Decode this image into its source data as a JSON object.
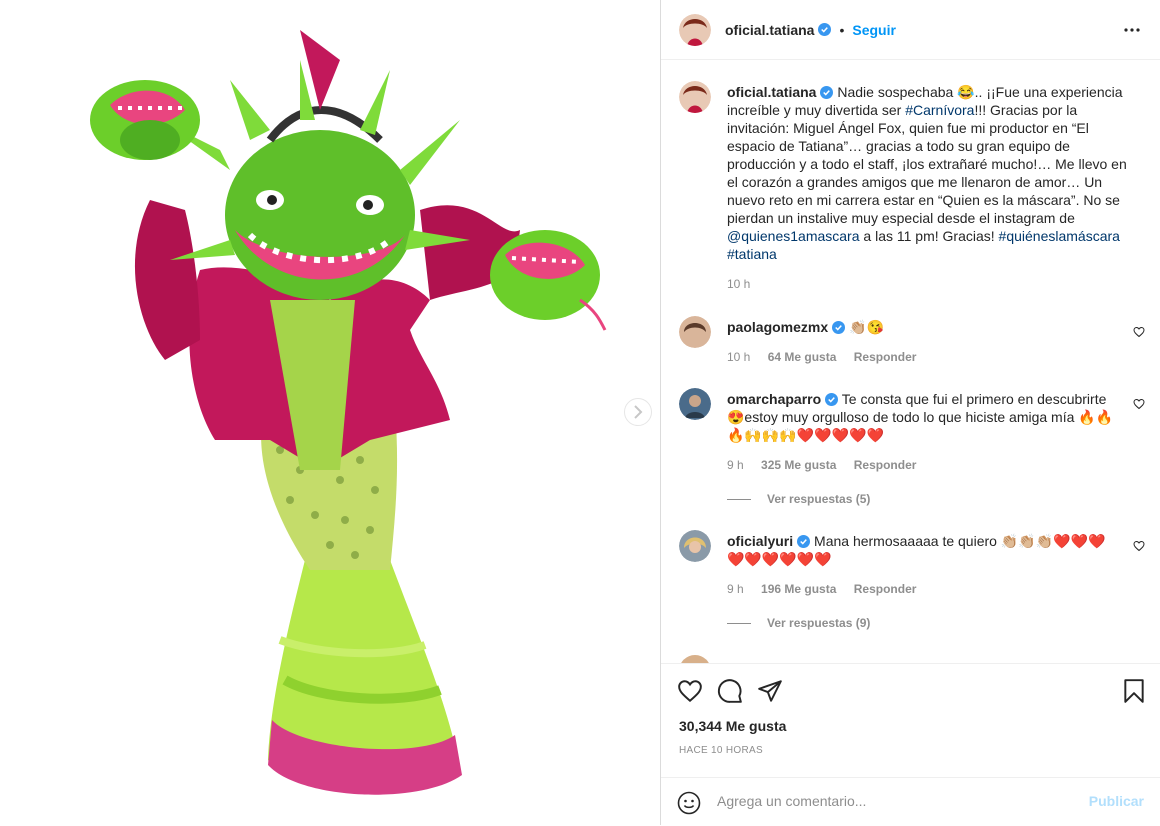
{
  "post": {
    "author": "oficial.tatiana",
    "follow_label": "Seguir",
    "dot": "•",
    "caption_author": "oficial.tatiana",
    "caption_text_1": "Nadie sospechaba 😂.. ¡¡Fue una experiencia increíble y muy divertida ser ",
    "caption_tag_1": "#Carnívora",
    "caption_text_2": "!!! Gracias por la invitación: Miguel Ángel Fox, quien fue mi productor en “El espacio de Tatiana”… gracias a todo su gran equipo de producción y a todo el staff, ¡los extrañaré mucho!… Me llevo en el corazón a grandes amigos que me llenaron de amor… Un nuevo reto en mi carrera estar en “Quien es la máscara”. No se pierdan un instalive muy especial desde el instagram de ",
    "caption_mention": "@quienes1amascara",
    "caption_text_3": " a las 11 pm! Gracias! ",
    "caption_tag_2": "#quiéneslamáscara",
    "caption_tag_3": "#tatiana",
    "caption_time": "10 h"
  },
  "comments": [
    {
      "user": "paolagomezmx",
      "text": "👏🏼😘",
      "time": "10 h",
      "likes": "64 Me gusta",
      "reply": "Responder"
    },
    {
      "user": "omarchaparro",
      "text": "Te consta que fui el primero en descubrirte 😍estoy muy orgulloso de todo lo que hiciste amiga mía 🔥🔥🔥🙌🙌🙌❤️❤️❤️❤️❤️",
      "time": "9 h",
      "likes": "325 Me gusta",
      "reply": "Responder",
      "view_replies": "Ver respuestas (5)"
    },
    {
      "user": "oficialyuri",
      "text": "Mana hermosaaaaa te quiero 👏🏼👏🏼👏🏼❤️❤️❤️❤️❤️❤️❤️❤️❤️",
      "time": "9 h",
      "likes": "196 Me gusta",
      "reply": "Responder",
      "view_replies": "Ver respuestas (9)"
    }
  ],
  "footer": {
    "likes": "30,344 Me gusta",
    "ago": "HACE 10 HORAS",
    "comment_placeholder": "Agrega un comentario...",
    "publish_label": "Publicar"
  },
  "colors": {
    "link": "#00376b",
    "follow": "#0095f6",
    "muted": "#8e8e8e",
    "publish_disabled": "#b2dffc",
    "costume_pink": "#c2185b",
    "costume_green": "#6ccf2a"
  },
  "icons": [
    "verified-icon",
    "more-options-icon",
    "next-arrow-icon",
    "heart-icon",
    "comment-icon",
    "share-icon",
    "bookmark-icon",
    "emoji-icon"
  ]
}
